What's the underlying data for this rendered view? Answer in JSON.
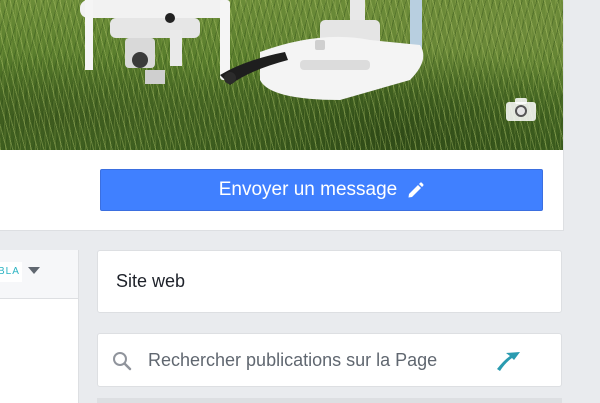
{
  "cover": {
    "photo_subject": "drone-on-grass",
    "camera_icon": "camera-icon"
  },
  "actions": {
    "send_message_label": "Envoyer un message",
    "send_message_icon": "pencil-icon"
  },
  "left_panel": {
    "brand_text": "BLA",
    "dropdown_icon": "chevron-down-icon"
  },
  "sidebar": {
    "website_label": "Site web",
    "search_placeholder": "Rechercher publications sur la Page",
    "search_icon": "search-icon"
  },
  "colors": {
    "primary_button": "#4080ff",
    "page_background": "#e9ebee",
    "brand_teal": "#2ab3c2"
  }
}
